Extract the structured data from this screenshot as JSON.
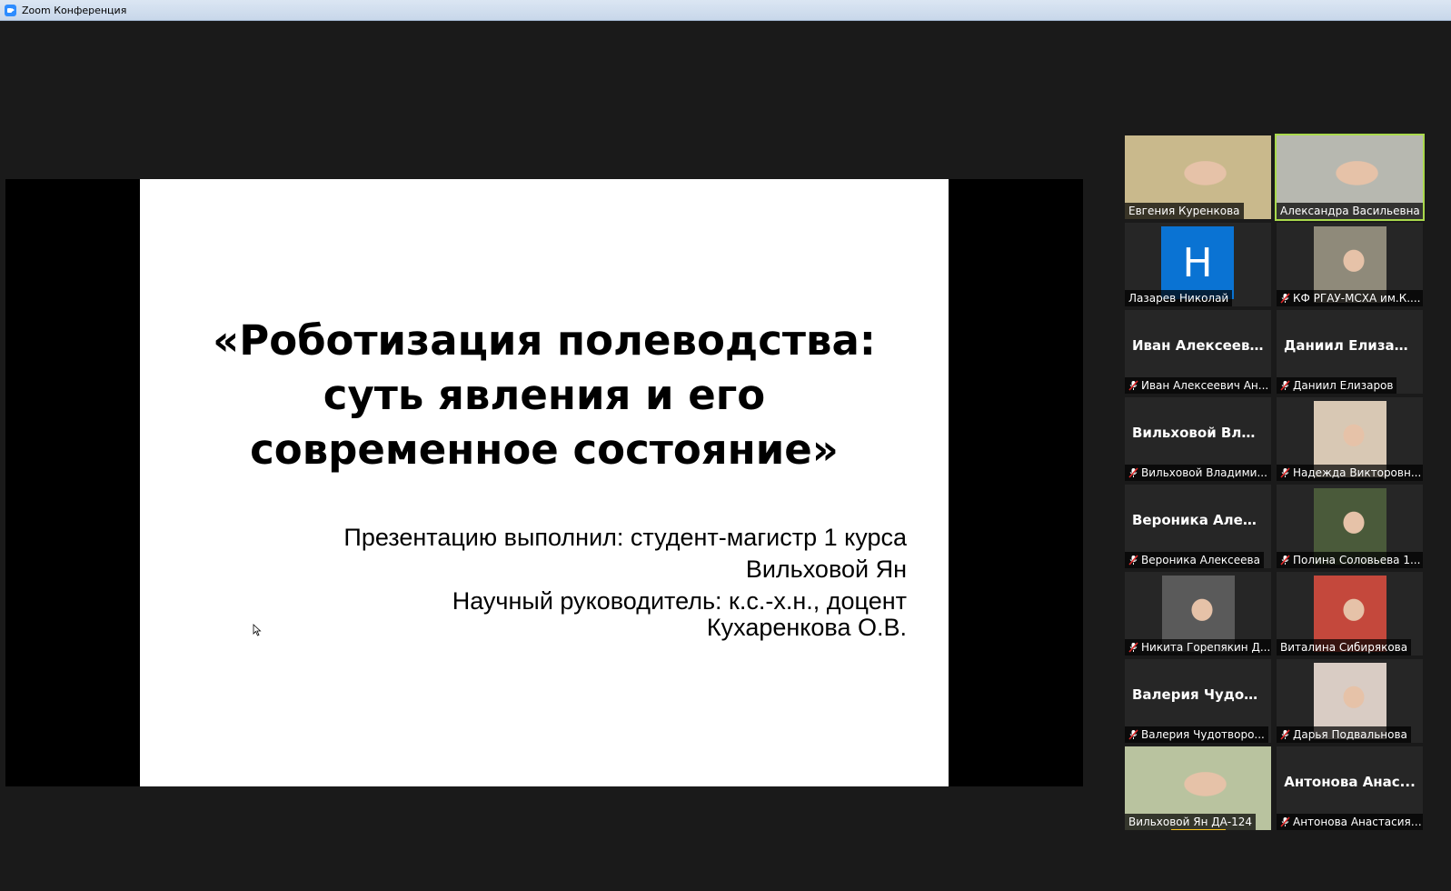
{
  "window": {
    "title": "Zoom Конференция"
  },
  "slide": {
    "title_lines": [
      "«Роботизация полеводства:",
      "суть явления и его",
      "современное состояние»"
    ],
    "author_line": "Презентацию выполнил: студент-магистр 1 курса",
    "author_name": "Вильховой Ян",
    "supervisor_line": "Научный руководитель: к.с.-х.н., доцент Кухаренкова О.В."
  },
  "participants": [
    {
      "label": "Евгения Куренкова",
      "muted": false,
      "kind": "video",
      "palette": "#c9b98c"
    },
    {
      "label": "Александра Васильевна",
      "muted": false,
      "kind": "video",
      "active": true,
      "palette": "#b7b8b0"
    },
    {
      "label": "Лазарев Николай",
      "muted": false,
      "kind": "letter",
      "letter": "Н"
    },
    {
      "label": "КФ РГАУ-МСХА им.К....",
      "muted": true,
      "kind": "video",
      "palette": "#8f8a7a"
    },
    {
      "label": "Иван Алексеевич Ан...",
      "muted": true,
      "kind": "name",
      "big": "Иван  Алексеев..."
    },
    {
      "label": "Даниил Елизаров",
      "muted": true,
      "kind": "name",
      "big": "Даниил  Елизар..."
    },
    {
      "label": "Вильховой Владими...",
      "muted": true,
      "kind": "name",
      "big": "Вильховой  Вла..."
    },
    {
      "label": "Надежда Викторовн...",
      "muted": true,
      "kind": "video",
      "palette": "#d8c8b4"
    },
    {
      "label": "Вероника Алексеева",
      "muted": true,
      "kind": "name",
      "big": "Вероника  Алек..."
    },
    {
      "label": "Полина Соловьева 1...",
      "muted": true,
      "kind": "video",
      "palette": "#4a5a3a"
    },
    {
      "label": "Никита Горепякин Д...",
      "muted": true,
      "kind": "video",
      "palette": "#5a5a5a"
    },
    {
      "label": "Виталина Сибирякова",
      "muted": false,
      "kind": "video",
      "palette": "#c4483c"
    },
    {
      "label": "Валерия Чудотворо...",
      "muted": true,
      "kind": "name",
      "big": "Валерия  Чудот..."
    },
    {
      "label": "Дарья Подвальнова",
      "muted": true,
      "kind": "video",
      "palette": "#d9ccc4"
    },
    {
      "label": "Вильховой Ян ДА-124",
      "muted": false,
      "kind": "video",
      "speaking": true,
      "palette": "#b9c39f"
    },
    {
      "label": "Антонова Анастасия ...",
      "muted": true,
      "kind": "name",
      "big": "Антонова  Анас..."
    }
  ]
}
